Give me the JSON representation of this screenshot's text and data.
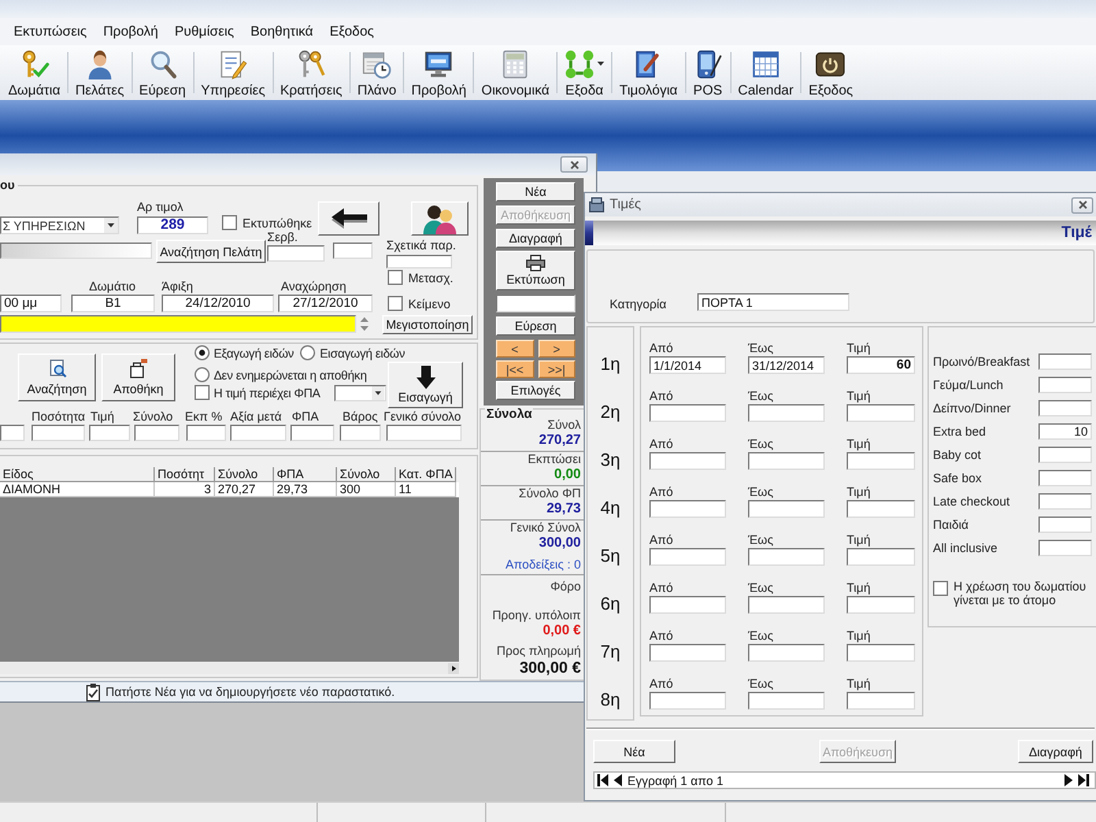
{
  "menu": [
    "Εκτυπώσεις",
    "Προβολή",
    "Ρυθμίσεις",
    "Βοηθητικά",
    "Εξοδος"
  ],
  "toolbar": [
    {
      "label": "Δωμάτια",
      "dropdown": false
    },
    {
      "label": "Πελάτες",
      "dropdown": false
    },
    {
      "label": "Εύρεση",
      "dropdown": false
    },
    {
      "label": "Υπηρεσίες",
      "dropdown": false
    },
    {
      "label": "Κρατήσεις",
      "dropdown": false
    },
    {
      "label": "Πλάνο",
      "dropdown": false
    },
    {
      "label": "Προβολή",
      "dropdown": false
    },
    {
      "label": "Οικονομικά",
      "dropdown": false
    },
    {
      "label": "Εξοδα",
      "dropdown": true
    },
    {
      "label": "Τιμολόγια",
      "dropdown": false
    },
    {
      "label": "POS",
      "dropdown": false
    },
    {
      "label": "Calendar",
      "dropdown": false
    },
    {
      "label": "Εξοδος",
      "dropdown": false
    }
  ],
  "invoice_window": {
    "group_label": "ου",
    "series": "Σ ΥΠΗΡΕΣΙΩΝ",
    "number_label": "Αρ τιμολ",
    "number": "289",
    "printed": {
      "label": "Εκτυπώθηκε",
      "checked": false
    },
    "customer_search_button": "Αναζήτηση Πελάτη",
    "server_label": "Σερβ.",
    "related_label": "Σχετικά παρ.",
    "convert": {
      "label": "Μετασχ.",
      "checked": false
    },
    "room_label": "Δωμάτιο",
    "arrival_label": "Άφιξη",
    "departure_label": "Αναχώρηση",
    "time": "00 μμ",
    "room": "Β1",
    "arrival": "24/12/2010",
    "departure": "27/12/2010",
    "text_option": {
      "label": "Κείμενο",
      "checked": false
    },
    "maximize_button": "Μεγιστοποίηση",
    "search_button": "Αναζήτηση",
    "warehouse_button": "Αποθήκη",
    "movement": [
      {
        "label": "Εξαγωγή ειδών",
        "selected": true
      },
      {
        "label": "Εισαγωγή ειδών",
        "selected": false
      },
      {
        "label": "Δεν ενημερώνεται η αποθήκη",
        "selected": false
      }
    ],
    "vat_included": {
      "label": "Η τιμή περιέχει ΦΠΑ",
      "checked": false
    },
    "insert_button": "Εισαγωγή",
    "entry_columns": [
      "Ποσότητα",
      "Τιμή",
      "Σύνολο",
      "Εκπ %",
      "Αξία μετά",
      "ΦΠΑ",
      "Βάρος",
      "Γενικό σύνολο"
    ],
    "table": {
      "columns": [
        "Είδος",
        "Ποσότητ",
        "Σύνολο",
        "ΦΠΑ",
        "Σύνολο",
        "Κατ. ΦΠΑ"
      ],
      "rows": [
        [
          "ΔΙΑΜΟΝΗ",
          "3",
          "270,27",
          "29,73",
          "300",
          "11"
        ]
      ]
    },
    "status_message": "Πατήστε Νέα για να δημιουργήσετε νέο παραστατικό."
  },
  "commands": {
    "buttons": [
      {
        "label": "Νέα",
        "disabled": false
      },
      {
        "label": "Αποθήκευση",
        "disabled": true
      },
      {
        "label": "Διαγραφή",
        "disabled": false
      }
    ],
    "print_button": "Εκτύπωση",
    "find_button": "Εύρεση",
    "navigation": [
      "<",
      ">",
      "|<<",
      ">>|"
    ],
    "options_button": "Επιλογές"
  },
  "totals": {
    "title": "Σύνολα",
    "sections": [
      [
        {
          "kind": "label",
          "text": "Σύνολ"
        },
        {
          "kind": "amount",
          "text": "270,27",
          "color": "#1f1f9e"
        }
      ],
      [
        {
          "kind": "label",
          "text": "Εκπτώσει"
        },
        {
          "kind": "amount",
          "text": "0,00",
          "color": "#138a13"
        }
      ],
      [
        {
          "kind": "label",
          "text": "Σύνολο ΦΠ"
        },
        {
          "kind": "amount",
          "text": "29,73",
          "color": "#1f1f9e"
        }
      ],
      [
        {
          "kind": "label",
          "text": "Γενικό Σύνολ"
        },
        {
          "kind": "amount",
          "text": "300,00",
          "color": "#1f1f9e"
        },
        {
          "kind": "note",
          "text": "Αποδείξεις : 0",
          "color": "#2b4fc2"
        }
      ],
      [
        {
          "kind": "heading",
          "text": "Φόρο"
        },
        {
          "kind": "label",
          "text": "Προηγ. υπόλοιπ"
        },
        {
          "kind": "amount",
          "text": "0,00 €",
          "color": "#e01b1b"
        },
        {
          "kind": "label",
          "text": "Προς πληρωμή"
        },
        {
          "kind": "total",
          "text": "300,00 €",
          "color": "#111111"
        }
      ]
    ]
  },
  "prices_dialog": {
    "title": "Τιμές",
    "header": "Τιμέ",
    "category_label": "Κατηγορία",
    "category": "ΠΟΡΤΑ 1",
    "periods": [
      {
        "number": "1η",
        "from_label": "Από",
        "to_label": "Έως",
        "price_label": "Τιμή",
        "from": "1/1/2014",
        "to": "31/12/2014",
        "price": "60"
      },
      {
        "number": "2η",
        "from_label": "Από",
        "to_label": "Έως",
        "price_label": "Τιμή"
      },
      {
        "number": "3η",
        "from_label": "Από",
        "to_label": "Έως",
        "price_label": "Τιμή"
      },
      {
        "number": "4η",
        "from_label": "Από",
        "to_label": "Έως",
        "price_label": "Τιμή"
      },
      {
        "number": "5η",
        "from_label": "Από",
        "to_label": "Έως",
        "price_label": "Τιμή"
      },
      {
        "number": "6η",
        "from_label": "Από",
        "to_label": "Έως",
        "price_label": "Τιμή"
      },
      {
        "number": "7η",
        "from_label": "Από",
        "to_label": "Έως",
        "price_label": "Τιμή"
      },
      {
        "number": "8η",
        "from_label": "Από",
        "to_label": "Έως",
        "price_label": "Τιμή"
      }
    ],
    "extras": [
      {
        "label": "Πρωινό/Breakfast"
      },
      {
        "label": "Γεύμα/Lunch"
      },
      {
        "label": "Δείπνο/Dinner"
      },
      {
        "label": "Extra bed",
        "value": "10"
      },
      {
        "label": "Baby cot"
      },
      {
        "label": "Safe box"
      },
      {
        "label": "Late checkout"
      },
      {
        "label": "Παιδιά"
      },
      {
        "label": "All inclusive"
      }
    ],
    "per_person": {
      "label": "Η χρέωση του δωματίου γίνεται με το άτομο",
      "checked": false
    },
    "buttons": [
      {
        "label": "Νέα",
        "disabled": false
      },
      {
        "label": "Αποθήκευση",
        "disabled": true
      },
      {
        "label": "Διαγραφή",
        "disabled": false
      }
    ],
    "record_position": "Εγγραφή 1 απο 1"
  }
}
